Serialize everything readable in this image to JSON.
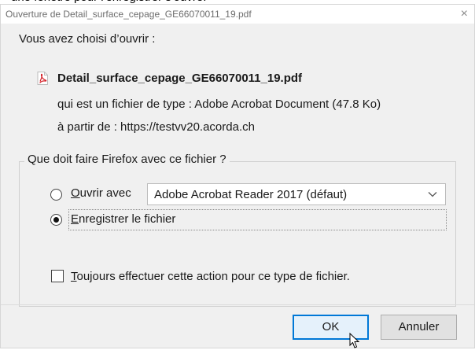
{
  "dialog": {
    "title": "Ouverture de Detail_surface_cepage_GE66070011_19.pdf",
    "close_glyph": "×",
    "intro": "Vous avez choisi d’ouvrir :",
    "file": {
      "icon": "pdf-file-icon",
      "name": "Detail_surface_cepage_GE66070011_19.pdf",
      "type_line": "qui est un fichier de type : Adobe Acrobat Document (47.8 Ko)",
      "source_line": "à partir de : https://testvv20.acorda.ch"
    },
    "question": "Que doit faire Firefox avec ce fichier ?",
    "open_with": {
      "label_accel": "O",
      "label_rest": "uvrir avec",
      "selected": false,
      "app_value": "Adobe Acrobat Reader 2017  (défaut)"
    },
    "save": {
      "label_accel": "E",
      "label_rest": "nregistrer le fichier",
      "selected": true
    },
    "always": {
      "label_accel": "T",
      "label_rest": "oujours effectuer cette action pour ce type de fichier.",
      "checked": false
    },
    "buttons": {
      "ok": "OK",
      "cancel": "Annuler"
    }
  },
  "colors": {
    "dialog_bg": "#f0f0f0",
    "title_text": "#6d6d6d",
    "pdf_red": "#d4232b",
    "ok_border": "#0078d7"
  }
}
